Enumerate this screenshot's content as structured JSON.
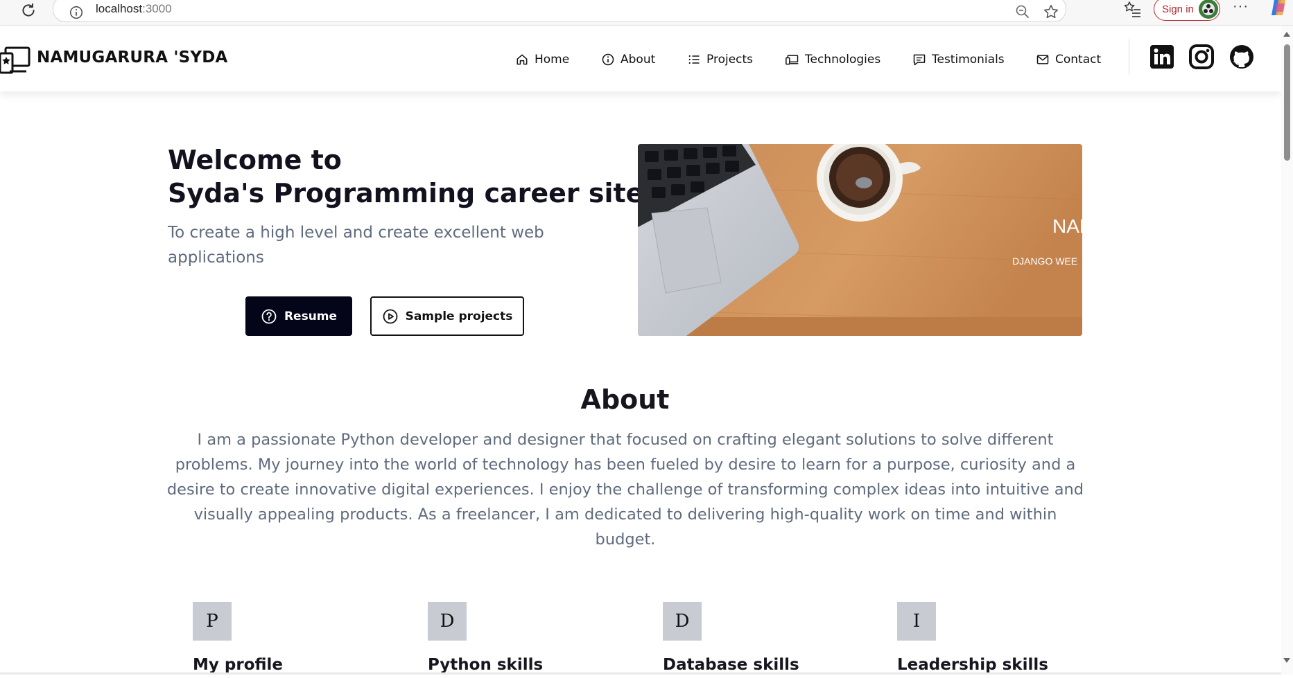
{
  "browser": {
    "url_host": "localhost",
    "url_port": ":3000",
    "sign_in_label": "Sign in"
  },
  "header": {
    "brand": "NAMUGARURA 'SYDA",
    "nav": [
      {
        "label": "Home",
        "icon": "home-icon"
      },
      {
        "label": "About",
        "icon": "info-icon"
      },
      {
        "label": "Projects",
        "icon": "list-icon"
      },
      {
        "label": "Technologies",
        "icon": "devices-icon"
      },
      {
        "label": "Testimonials",
        "icon": "chat-icon"
      },
      {
        "label": "Contact",
        "icon": "mail-icon"
      }
    ],
    "social": [
      "linkedin-icon",
      "instagram-icon",
      "github-icon"
    ]
  },
  "hero": {
    "title_line1": "Welcome to",
    "title_line2": "Syda's Programming career site",
    "subtitle": "To create a high level and create excellent web applications",
    "resume_label": "Resume",
    "sample_label": "Sample projects",
    "image_text_main": "NAM",
    "image_text_sub": "DJANGO WEE"
  },
  "about": {
    "title": "About",
    "text": "I am a passionate Python developer and designer that focused on crafting elegant solutions to solve different problems. My journey into the world of technology has been fueled by desire to learn for a purpose, curiosity and a desire to create innovative digital experiences. I enjoy the challenge of transforming complex ideas into intuitive and visually appealing products. As a freelancer, I am dedicated to delivering high-quality work on time and within budget."
  },
  "skills": [
    {
      "letter": "P",
      "name": "My profile"
    },
    {
      "letter": "D",
      "name": "Python skills"
    },
    {
      "letter": "D",
      "name": "Database skills"
    },
    {
      "letter": "I",
      "name": "Leadership skills"
    }
  ],
  "colors": {
    "dark_button": "#05051a",
    "muted_text": "#5f6b7d",
    "sign_in_accent": "#b3262d"
  }
}
